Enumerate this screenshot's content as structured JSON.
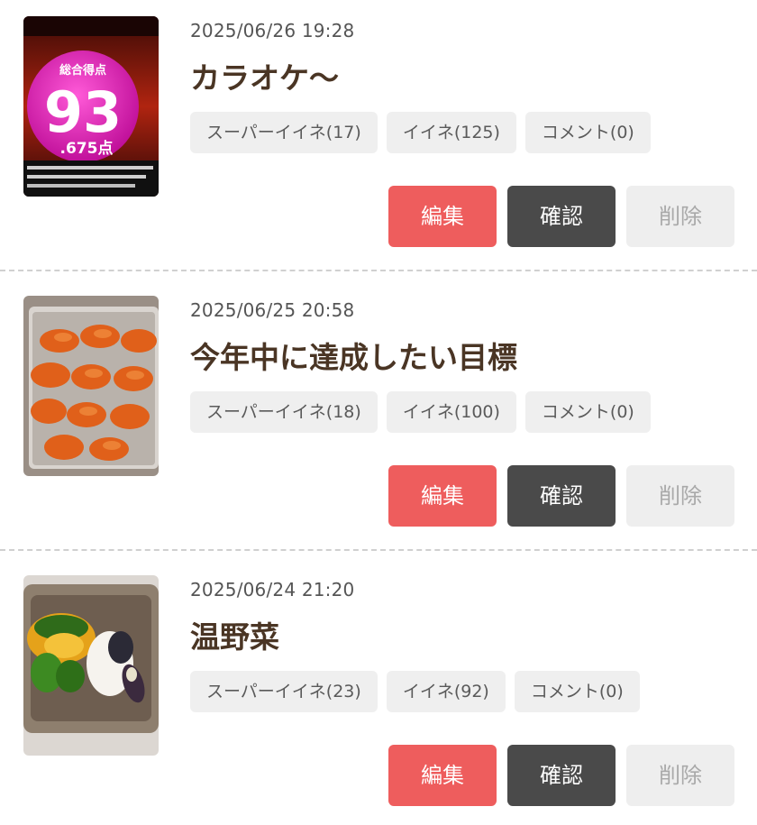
{
  "colors": {
    "edit": "#ee5d5d",
    "confirm": "#4a4a4a",
    "delete": "#eeeeee",
    "tag_bg": "#efefef",
    "title": "#4a3524"
  },
  "posts": [
    {
      "date": "2025/06/26 19:28",
      "title": "カラオケ〜",
      "thumb_icon": "karaoke-score-photo",
      "thumb_text": {
        "label": "総合得点",
        "score": "93",
        "decimal": ".675点"
      },
      "tags": [
        "スーパーイイネ(17)",
        "イイネ(125)",
        "コメント(0)"
      ],
      "buttons": {
        "edit": "編集",
        "confirm": "確認",
        "delete": "削除"
      }
    },
    {
      "date": "2025/06/25 20:58",
      "title": "今年中に達成したい目標",
      "thumb_icon": "carrot-dish-photo",
      "tags": [
        "スーパーイイネ(18)",
        "イイネ(100)",
        "コメント(0)"
      ],
      "buttons": {
        "edit": "編集",
        "confirm": "確認",
        "delete": "削除"
      }
    },
    {
      "date": "2025/06/24 21:20",
      "title": "温野菜",
      "thumb_icon": "steamed-vegetables-photo",
      "tags": [
        "スーパーイイネ(23)",
        "イイネ(92)",
        "コメント(0)"
      ],
      "buttons": {
        "edit": "編集",
        "confirm": "確認",
        "delete": "削除"
      }
    }
  ]
}
